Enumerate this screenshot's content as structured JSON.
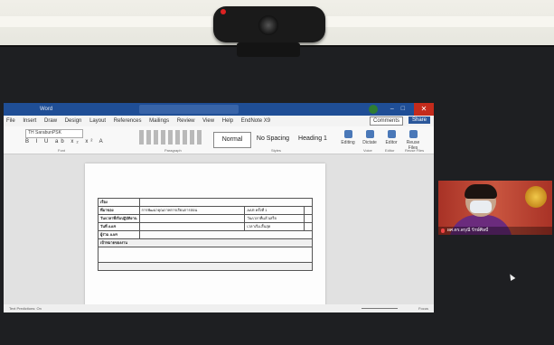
{
  "word": {
    "title_text": "Word",
    "tabs": [
      "File",
      "Insert",
      "Draw",
      "Design",
      "Layout",
      "References",
      "Mailings",
      "Review",
      "View",
      "Help",
      "EndNote X9"
    ],
    "comments_label": "Comments",
    "share_label": "Share",
    "close_glyph": "✕",
    "ribbon": {
      "font_name": "TH SarabunPSK",
      "styles": [
        "Normal",
        "No Spacing",
        "Heading 1"
      ],
      "tools": [
        "Editing",
        "Dictate",
        "Editor",
        "Reuse Files"
      ],
      "groups": [
        "Font",
        "Paragraph",
        "Styles",
        "Voice",
        "Editor",
        "Reuse Files"
      ]
    },
    "status_left": "Text Predictions: On",
    "status_right": "Focus"
  },
  "document": {
    "rows": [
      {
        "label": "เรื่อง",
        "value": ""
      },
      {
        "label": "ที่มาของ",
        "value": "การพัฒนาคุณภาพการเรียนการสอน",
        "extra_label": "AAR ครั้งที่ 1"
      },
      {
        "label": "วัน/เวลาที่เริ่มปฏิบัติงาน",
        "value": "",
        "extra_label": "วัน/เวลาที่แล้วเสร็จ"
      },
      {
        "label": "วันที่ AAR",
        "value": "",
        "extra_label": "เวลาเริ่ม-สิ้นสุด"
      },
      {
        "label": "ผู้ร่วม AAR",
        "value": ""
      },
      {
        "label": "เป้าหมายของงาน",
        "value": ""
      },
      {
        "label": "",
        "value": ""
      },
      {
        "label": "",
        "value": ""
      }
    ]
  },
  "participant": {
    "name": "ผศ.ดร.ดรุณี รักษ์ศิลป์"
  }
}
